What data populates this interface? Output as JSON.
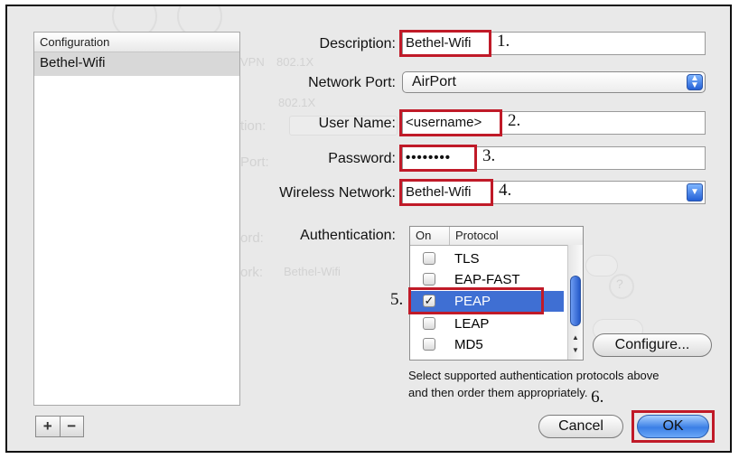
{
  "config_list": {
    "header": "Configuration",
    "items": [
      "Bethel-Wifi"
    ],
    "add_label": "+",
    "remove_label": "−"
  },
  "form": {
    "description": {
      "label": "Description:",
      "value": "Bethel-Wifi",
      "step": "1."
    },
    "network_port": {
      "label": "Network Port:",
      "value": "AirPort"
    },
    "user_name": {
      "label": "User Name:",
      "value": "<username>",
      "step": "2."
    },
    "password": {
      "label": "Password:",
      "value": "••••••••",
      "step": "3."
    },
    "wireless_network": {
      "label": "Wireless Network:",
      "value": "Bethel-Wifi",
      "step": "4."
    },
    "authentication": {
      "label": "Authentication:",
      "col_on": "On",
      "col_protocol": "Protocol",
      "step": "5.",
      "rows": [
        {
          "name": "TLS",
          "checked": false
        },
        {
          "name": "EAP-FAST",
          "checked": false
        },
        {
          "name": "PEAP",
          "checked": true
        },
        {
          "name": "LEAP",
          "checked": false
        },
        {
          "name": "MD5",
          "checked": false
        }
      ]
    },
    "configure_label": "Configure...",
    "help_text_1": "Select supported authentication protocols above",
    "help_text_2": "and then order them appropriately.",
    "step_ok": "6."
  },
  "buttons": {
    "cancel": "Cancel",
    "ok": "OK"
  },
  "background_ghost": {
    "vpn": "VPN",
    "x1": "802.1X",
    "tion": "tion:",
    "port": "Port:",
    "ord": "ord:",
    "ork": "ork:",
    "network_name": "Bethel-Wifi",
    "help": "?"
  },
  "colors": {
    "annotation": "#c01a28",
    "selection": "#3f6fd3"
  }
}
